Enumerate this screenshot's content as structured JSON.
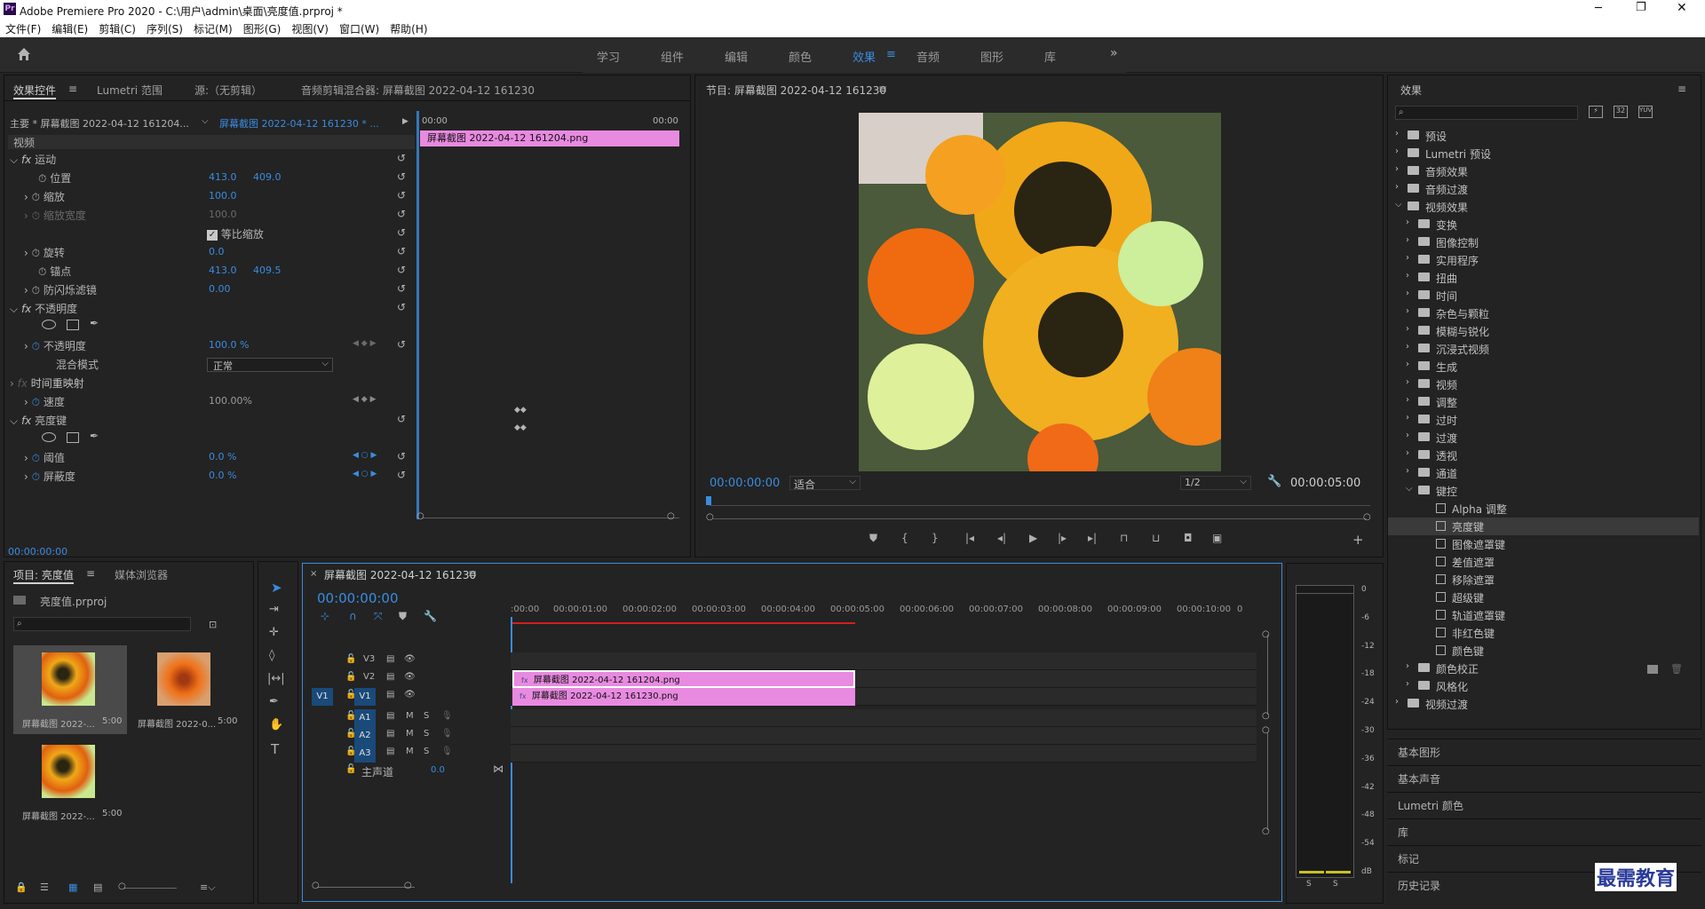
{
  "window": {
    "title": "Adobe Premiere Pro 2020 - C:\\用户\\admin\\桌面\\亮度值.prproj *",
    "min_icon": "minimize-icon",
    "max_icon": "restore-icon",
    "close_icon": "close-icon"
  },
  "menu": [
    "文件(F)",
    "编辑(E)",
    "剪辑(C)",
    "序列(S)",
    "标记(M)",
    "图形(G)",
    "视图(V)",
    "窗口(W)",
    "帮助(H)"
  ],
  "workspaces": [
    "学习",
    "组件",
    "编辑",
    "颜色",
    "效果",
    "音频",
    "图形",
    "库"
  ],
  "active_workspace": "效果",
  "colors": {
    "accent": "#3a8ce0",
    "clip": "#e88ae0",
    "bg": "#232323"
  },
  "effect_controls": {
    "tabs": [
      "效果控件",
      "Lumetri 范围",
      "源:（无剪辑）",
      "音频剪辑混合器: 屏幕截图 2022-04-12 161230"
    ],
    "master": "主要 * 屏幕截图 2022-04-12 161204...",
    "sequence": "屏幕截图 2022-04-12 161230 * ...",
    "start_time": "00:00",
    "end_time": "00:00",
    "clip_name": "屏幕截图 2022-04-12  161204.png",
    "section_video": "视频",
    "motion": "运动",
    "position": {
      "label": "位置",
      "x": "413.0",
      "y": "409.0"
    },
    "scale": {
      "label": "缩放",
      "value": "100.0"
    },
    "scale_width": {
      "label": "缩放宽度",
      "value": "100.0"
    },
    "uniform_scale": "等比缩放",
    "rotation": {
      "label": "旋转",
      "value": "0.0"
    },
    "anchor": {
      "label": "锚点",
      "x": "413.0",
      "y": "409.5"
    },
    "antiflicker": {
      "label": "防闪烁滤镜",
      "value": "0.00"
    },
    "opacity_section": "不透明度",
    "opacity": {
      "label": "不透明度",
      "value": "100.0 %"
    },
    "blend_mode": {
      "label": "混合模式",
      "value": "正常"
    },
    "time_remap": "时间重映射",
    "speed": {
      "label": "速度",
      "value": "100.00%"
    },
    "luma_key": "亮度键",
    "threshold": {
      "label": "阈值",
      "value": "0.0 %"
    },
    "cutoff": {
      "label": "屏蔽度",
      "value": "0.0 %"
    },
    "timecode": "00:00:00:00"
  },
  "program": {
    "title": "节目: 屏幕截图 2022-04-12 161230",
    "timecode": "00:00:00:00",
    "fit": "适合",
    "resolution": "1/2",
    "duration": "00:00:05:00"
  },
  "project": {
    "tabs": [
      "项目: 亮度值",
      "媒体浏览器"
    ],
    "file": "亮度值.prproj",
    "items": [
      {
        "name": "屏幕截图 2022-...",
        "dur": "5:00"
      },
      {
        "name": "屏幕截图 2022-0...",
        "dur": "5:00"
      },
      {
        "name": "屏幕截图 2022-...",
        "dur": "5:00"
      }
    ]
  },
  "timeline": {
    "title": "屏幕截图 2022-04-12 161230",
    "timecode": "00:00:00:00",
    "ticks": [
      ":00:00",
      "00:00:01:00",
      "00:00:02:00",
      "00:00:03:00",
      "00:00:04:00",
      "00:00:05:00",
      "00:00:06:00",
      "00:00:07:00",
      "00:00:08:00",
      "00:00:09:00",
      "00:00:10:00",
      "0"
    ],
    "tracks_video": [
      "V3",
      "V2",
      "V1"
    ],
    "tracks_audio": [
      "A1",
      "A2",
      "A3"
    ],
    "source_patch": "V1",
    "mute": "M",
    "solo": "S",
    "master": "主声道",
    "master_value": "0.0",
    "clip_v2": "屏幕截图 2022-04-12  161204.png",
    "clip_v1": "屏幕截图 2022-04-12  161230.png"
  },
  "meter": {
    "scale": [
      "0",
      "-6",
      "-12",
      "-18",
      "-24",
      "-30",
      "-36",
      "-42",
      "-48",
      "-54",
      "dB"
    ],
    "labels": [
      "S",
      "S"
    ]
  },
  "effects": {
    "title": "效果",
    "tree": [
      {
        "label": "预设",
        "level": 0,
        "type": "folder",
        "open": false
      },
      {
        "label": "Lumetri 预设",
        "level": 0,
        "type": "folder",
        "open": false
      },
      {
        "label": "音频效果",
        "level": 0,
        "type": "folder",
        "open": false
      },
      {
        "label": "音频过渡",
        "level": 0,
        "type": "folder",
        "open": false
      },
      {
        "label": "视频效果",
        "level": 0,
        "type": "folder",
        "open": true
      },
      {
        "label": "变换",
        "level": 1,
        "type": "folder",
        "open": false
      },
      {
        "label": "图像控制",
        "level": 1,
        "type": "folder",
        "open": false
      },
      {
        "label": "实用程序",
        "level": 1,
        "type": "folder",
        "open": false
      },
      {
        "label": "扭曲",
        "level": 1,
        "type": "folder",
        "open": false
      },
      {
        "label": "时间",
        "level": 1,
        "type": "folder",
        "open": false
      },
      {
        "label": "杂色与颗粒",
        "level": 1,
        "type": "folder",
        "open": false
      },
      {
        "label": "模糊与锐化",
        "level": 1,
        "type": "folder",
        "open": false
      },
      {
        "label": "沉浸式视频",
        "level": 1,
        "type": "folder",
        "open": false
      },
      {
        "label": "生成",
        "level": 1,
        "type": "folder",
        "open": false
      },
      {
        "label": "视频",
        "level": 1,
        "type": "folder",
        "open": false
      },
      {
        "label": "调整",
        "level": 1,
        "type": "folder",
        "open": false
      },
      {
        "label": "过时",
        "level": 1,
        "type": "folder",
        "open": false
      },
      {
        "label": "过渡",
        "level": 1,
        "type": "folder",
        "open": false
      },
      {
        "label": "透视",
        "level": 1,
        "type": "folder",
        "open": false
      },
      {
        "label": "通道",
        "level": 1,
        "type": "folder",
        "open": false
      },
      {
        "label": "键控",
        "level": 1,
        "type": "folder",
        "open": true
      },
      {
        "label": "Alpha 调整",
        "level": 2,
        "type": "effect"
      },
      {
        "label": "亮度键",
        "level": 2,
        "type": "effect",
        "selected": true
      },
      {
        "label": "图像遮罩键",
        "level": 2,
        "type": "effect"
      },
      {
        "label": "差值遮罩",
        "level": 2,
        "type": "effect"
      },
      {
        "label": "移除遮罩",
        "level": 2,
        "type": "effect"
      },
      {
        "label": "超级键",
        "level": 2,
        "type": "effect"
      },
      {
        "label": "轨道遮罩键",
        "level": 2,
        "type": "effect"
      },
      {
        "label": "非红色键",
        "level": 2,
        "type": "effect"
      },
      {
        "label": "颜色键",
        "level": 2,
        "type": "effect"
      },
      {
        "label": "颜色校正",
        "level": 1,
        "type": "folder",
        "open": false
      },
      {
        "label": "风格化",
        "level": 1,
        "type": "folder",
        "open": false
      },
      {
        "label": "视频过渡",
        "level": 0,
        "type": "folder",
        "open": false
      }
    ],
    "panels": [
      "基本图形",
      "基本声音",
      "Lumetri 颜色",
      "库",
      "标记",
      "历史记录"
    ]
  },
  "watermark": "最需教育"
}
